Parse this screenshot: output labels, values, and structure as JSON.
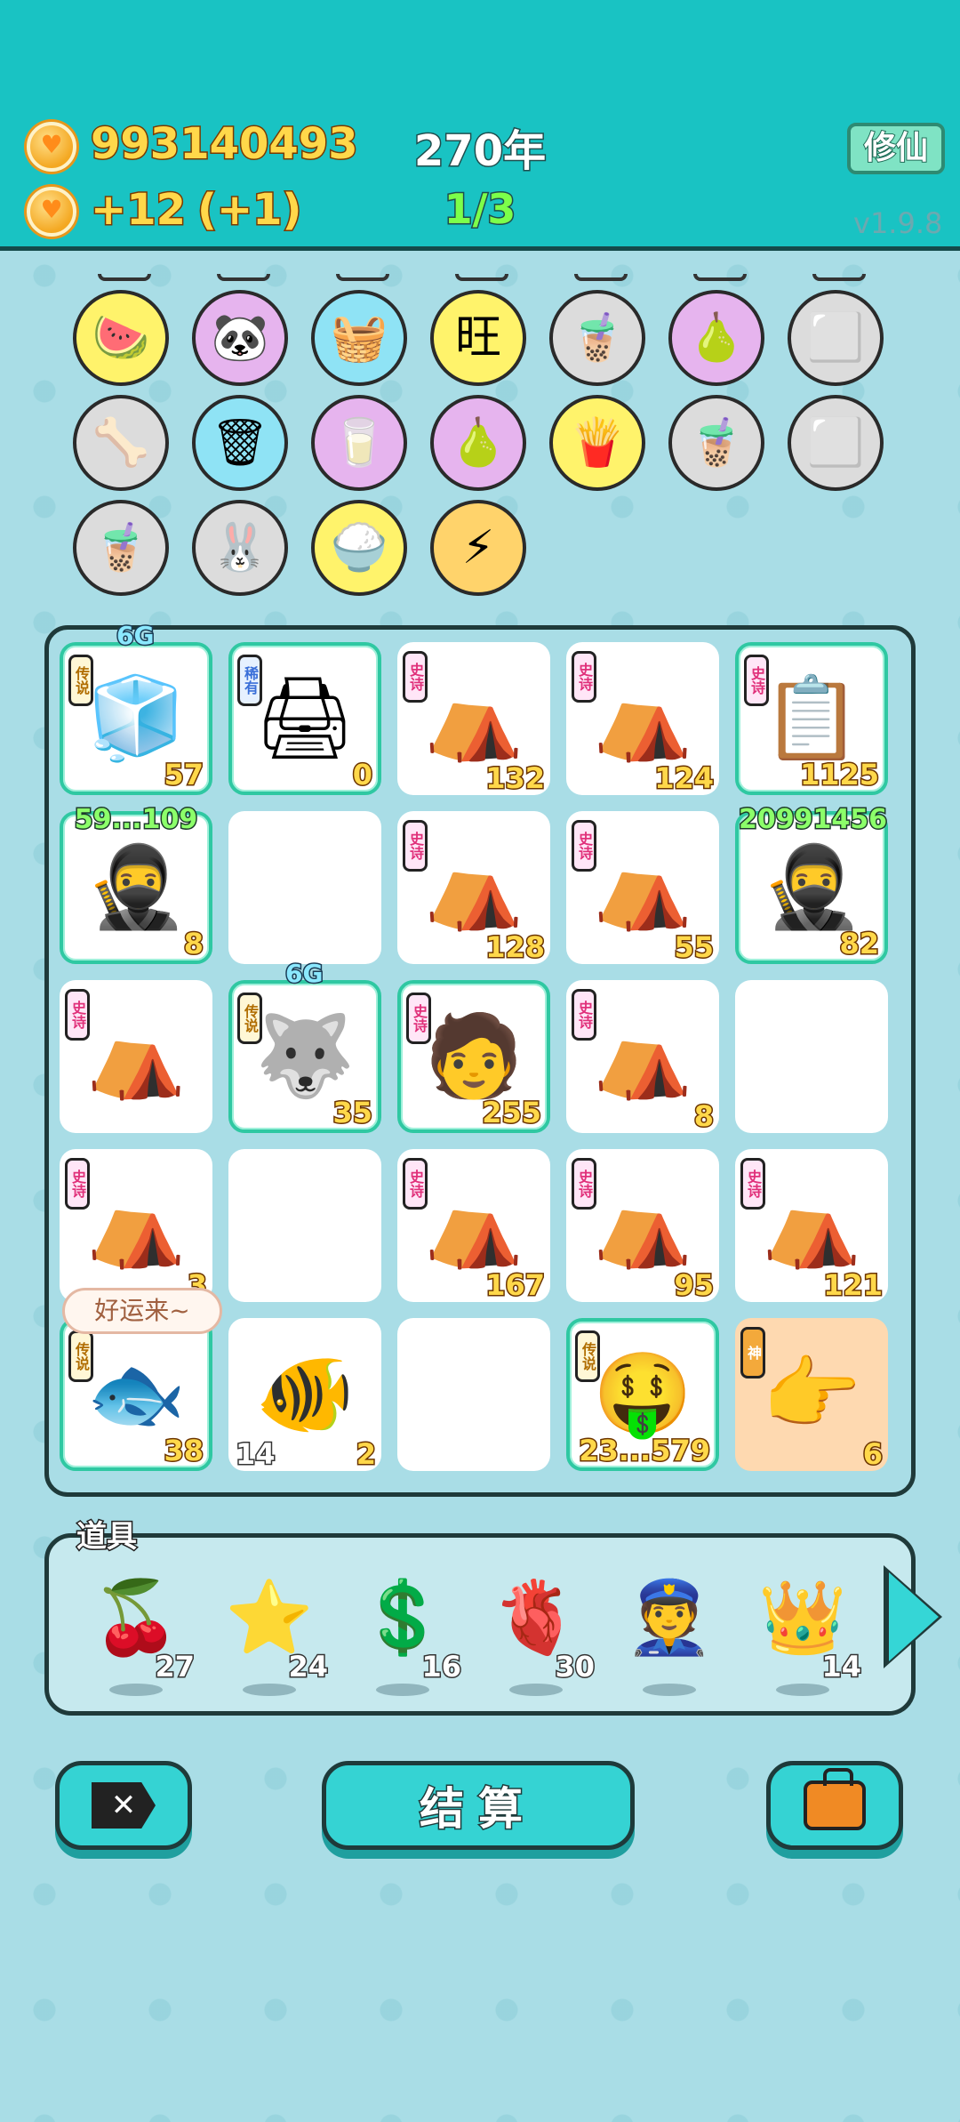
{
  "header": {
    "coins": "993140493",
    "income": "+12",
    "income_bonus": "(+1)",
    "year": "270年",
    "ratio": "1/3",
    "xiuxian_button": "修仙",
    "version": "v1.9.8"
  },
  "collection": [
    {
      "icon": "fruit-basket-icon",
      "glyph": "🍉",
      "bg": "#fff36b"
    },
    {
      "icon": "panda-icon",
      "glyph": "🐼",
      "bg": "#e6b4ee"
    },
    {
      "icon": "basket-icon",
      "glyph": "🧺",
      "bg": "#8fe3f5"
    },
    {
      "icon": "wang-tile-icon",
      "glyph": "旺",
      "bg": "#fff36b"
    },
    {
      "icon": "bubble-tea-icon",
      "glyph": "🧋",
      "bg": "#dcdcdc"
    },
    {
      "icon": "pomelo-icon",
      "glyph": "🍐",
      "bg": "#e6b4ee"
    },
    {
      "icon": "sugar-cubes-icon",
      "glyph": "⬜",
      "bg": "#dcdcdc"
    },
    {
      "icon": "dog-food-icon",
      "glyph": "🦴",
      "bg": "#dcdcdc"
    },
    {
      "icon": "garbage-bag-icon",
      "glyph": "🗑",
      "bg": "#8fe3f5"
    },
    {
      "icon": "milk-jar-icon",
      "glyph": "🥛",
      "bg": "#e6b4ee"
    },
    {
      "icon": "pomelo-icon",
      "glyph": "🍐",
      "bg": "#e6b4ee"
    },
    {
      "icon": "fries-icon",
      "glyph": "🍟",
      "bg": "#fff36b"
    },
    {
      "icon": "bubble-tea-icon",
      "glyph": "🧋",
      "bg": "#dcdcdc"
    },
    {
      "icon": "sugar-cubes-icon",
      "glyph": "⬜",
      "bg": "#dcdcdc"
    },
    {
      "icon": "bubble-tea-icon",
      "glyph": "🧋",
      "bg": "#dcdcdc"
    },
    {
      "icon": "rabbit-icon",
      "glyph": "🐰",
      "bg": "#dcdcdc"
    },
    {
      "icon": "rice-bowl-icon",
      "glyph": "🍚",
      "bg": "#fff36b"
    },
    {
      "icon": "lightning-icon",
      "glyph": "⚡",
      "bg": "#ffd36b"
    }
  ],
  "board": {
    "cells": [
      {
        "icon": "fridge-icon",
        "glyph": "🧊",
        "tag": "传说",
        "tag_color": "yellow",
        "num": "57",
        "hl": true,
        "badge_6g": true
      },
      {
        "icon": "printer-icon",
        "glyph": "🖨",
        "tag": "稀有",
        "tag_color": "blue",
        "num": "0",
        "hl": true
      },
      {
        "icon": "rabbit-tent-icon",
        "glyph": "⛺",
        "tag": "史诗",
        "tag_color": "pink",
        "num": "132"
      },
      {
        "icon": "rabbit-tent-icon",
        "glyph": "⛺",
        "tag": "史诗",
        "tag_color": "pink",
        "num": "124"
      },
      {
        "icon": "copy-paste-icon",
        "glyph": "📋",
        "tag": "史诗",
        "tag_color": "pink",
        "num": "1125",
        "hl": true
      },
      {
        "icon": "thief-icon",
        "glyph": "🥷",
        "num": "8",
        "hl": true,
        "topnum": "59...109"
      },
      {
        "empty": true
      },
      {
        "icon": "rabbit-tent-icon",
        "glyph": "⛺",
        "tag": "史诗",
        "tag_color": "pink",
        "num": "128"
      },
      {
        "icon": "rabbit-tent-icon",
        "glyph": "⛺",
        "tag": "史诗",
        "tag_color": "pink",
        "num": "55"
      },
      {
        "icon": "thief-icon",
        "glyph": "🥷",
        "num": "82",
        "hl": true,
        "topnum": "20991456"
      },
      {
        "icon": "rabbit-tent-icon",
        "glyph": "⛺",
        "tag": "史诗",
        "tag_color": "pink",
        "num": ""
      },
      {
        "icon": "husky-icon",
        "glyph": "🐺",
        "tag": "传说",
        "tag_color": "yellow",
        "num": "35",
        "hl": true,
        "badge_6g": true
      },
      {
        "icon": "green-hat-man-icon",
        "glyph": "🧑",
        "tag": "史诗",
        "tag_color": "pink",
        "num": "255",
        "hl": true
      },
      {
        "icon": "rabbit-tent-icon",
        "glyph": "⛺",
        "tag": "史诗",
        "tag_color": "pink",
        "num": "8"
      },
      {
        "empty": true
      },
      {
        "icon": "rabbit-tent-icon",
        "glyph": "⛺",
        "tag": "史诗",
        "tag_color": "pink",
        "num": "3"
      },
      {
        "empty": true
      },
      {
        "icon": "rabbit-tent-icon",
        "glyph": "⛺",
        "tag": "史诗",
        "tag_color": "pink",
        "num": "167"
      },
      {
        "icon": "rabbit-tent-icon",
        "glyph": "⛺",
        "tag": "史诗",
        "tag_color": "pink",
        "num": "95"
      },
      {
        "icon": "rabbit-tent-icon",
        "glyph": "⛺",
        "tag": "史诗",
        "tag_color": "pink",
        "num": "121"
      },
      {
        "icon": "koi-fish-icon",
        "glyph": "🐟",
        "tag": "传说",
        "tag_color": "yellow",
        "num": "38",
        "hl": true
      },
      {
        "icon": "fish-icon",
        "glyph": "🐠",
        "num": "2",
        "lnum": "14"
      },
      {
        "empty": true
      },
      {
        "icon": "rich-man-icon",
        "glyph": "🤑",
        "tag": "传说",
        "tag_color": "yellow",
        "num": "23...579",
        "hl": true
      },
      {
        "icon": "pointing-hand-icon",
        "glyph": "👉",
        "tag": "神",
        "tag_color": "orange",
        "num": "6",
        "peach": true
      }
    ],
    "bubble": "好运来~",
    "badge_6g": "6G"
  },
  "tools": {
    "label": "道具",
    "items": [
      {
        "icon": "lychee-icon",
        "glyph": "🍒",
        "count": "27"
      },
      {
        "icon": "star-icon",
        "glyph": "⭐",
        "count": "24"
      },
      {
        "icon": "dollar-coin-icon",
        "glyph": "💲",
        "count": "16"
      },
      {
        "icon": "liver-icon",
        "glyph": "🫀",
        "count": "30"
      },
      {
        "icon": "portrait-icon",
        "glyph": "👮",
        "count": ""
      },
      {
        "icon": "crown-icon",
        "glyph": "👑",
        "count": "14"
      }
    ]
  },
  "buttons": {
    "settle": "结算"
  }
}
